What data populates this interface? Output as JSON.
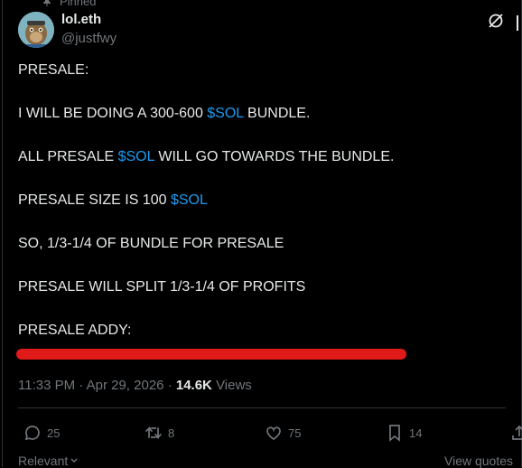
{
  "pinned": {
    "label": "Pinned"
  },
  "author": {
    "name": "lol.eth",
    "handle": "@justfwy"
  },
  "post": {
    "line1": "PRESALE:",
    "line2_prefix": "I WILL BE DOING A 300-600 ",
    "line2_tag": "$SOL",
    "line2_suffix": " BUNDLE.",
    "line3_prefix": "ALL PRESALE ",
    "line3_tag": "$SOL",
    "line3_suffix": " WILL GO TOWARDS THE BUNDLE.",
    "line4_prefix": "PRESALE SIZE IS 100 ",
    "line4_tag": "$SOL",
    "line5": "SO, 1/3-1/4 OF BUNDLE FOR PRESALE",
    "line6": "PRESALE WILL SPLIT 1/3-1/4 OF PROFITS",
    "line7": "PRESALE ADDY:"
  },
  "meta": {
    "time": "11:33 PM",
    "date": "Apr 29, 2026",
    "separator": "·",
    "views_count": "14.6K",
    "views_label": "Views"
  },
  "actions": {
    "replies": "25",
    "reposts": "8",
    "likes": "75",
    "bookmarks": "14"
  },
  "footer": {
    "sort_label": "Relevant",
    "view_quotes": "View quotes"
  },
  "colors": {
    "background": "#000000",
    "text": "#e7e9ea",
    "muted": "#71767b",
    "link": "#1d9bf0",
    "redaction": "#e01919"
  },
  "icons": [
    "pin-icon",
    "grok-icon",
    "more-icon",
    "reply-icon",
    "retweet-icon",
    "like-icon",
    "bookmark-icon",
    "share-icon",
    "chevron-down-icon"
  ]
}
